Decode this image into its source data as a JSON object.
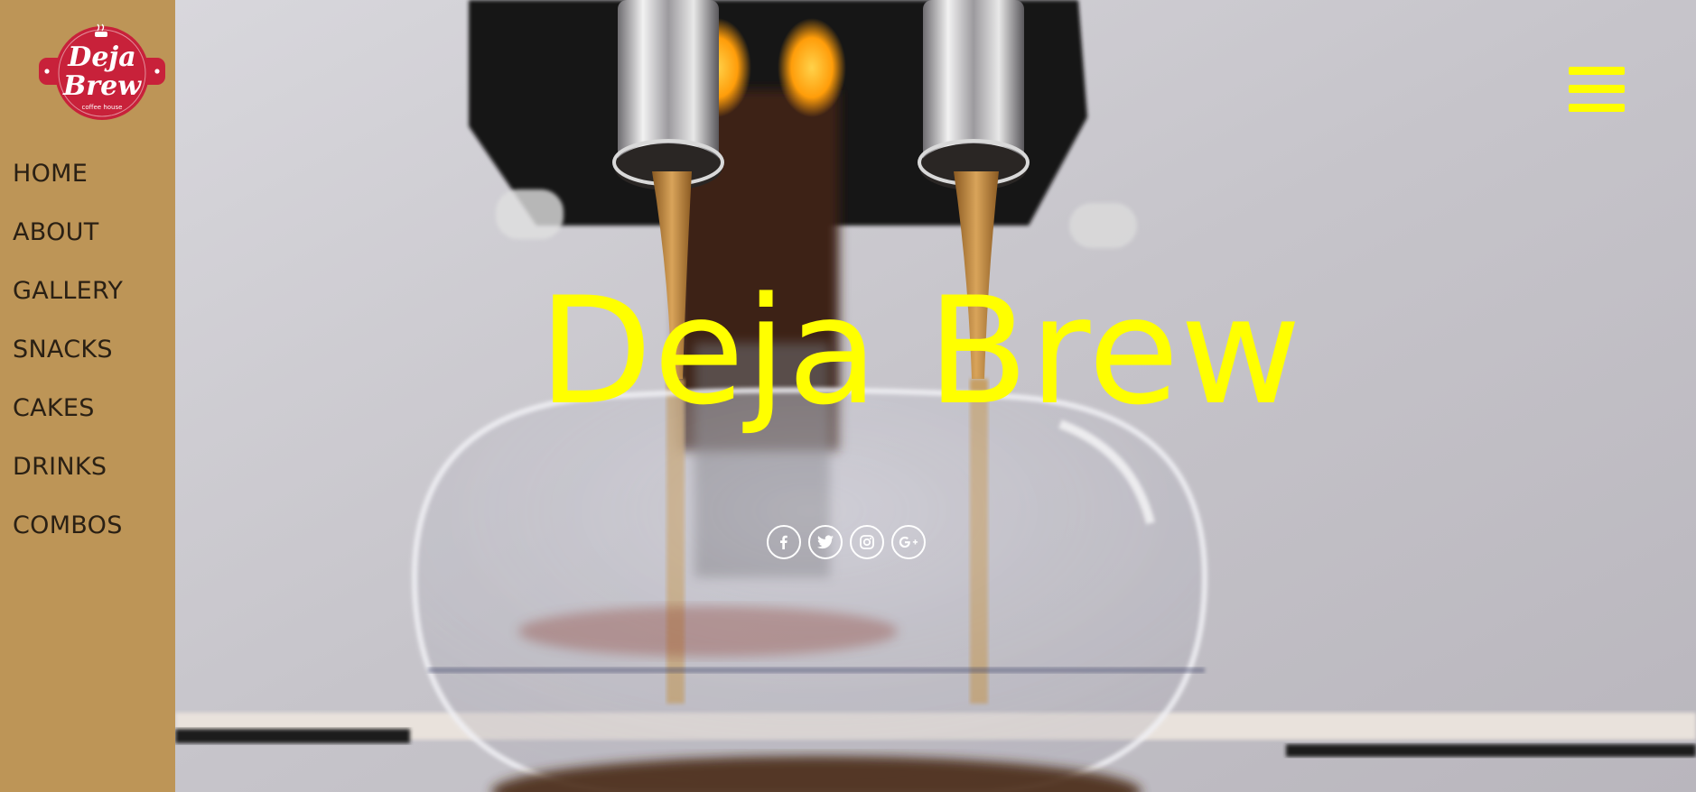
{
  "brand": {
    "logo_line1": "Deja",
    "logo_line2": "Brew",
    "logo_tagline": "coffee house",
    "primary_color": "#BD9557",
    "logo_color": "#C8213A",
    "accent_color": "#FFFF00"
  },
  "sidebar": {
    "items": [
      {
        "label": "HOME"
      },
      {
        "label": "ABOUT"
      },
      {
        "label": "GALLERY"
      },
      {
        "label": "SNACKS"
      },
      {
        "label": "CAKES"
      },
      {
        "label": "DRINKS"
      },
      {
        "label": "COMBOS"
      }
    ]
  },
  "hero": {
    "title": "Deja Brew",
    "background": "espresso-machine-pouring-image"
  },
  "header": {
    "menu_icon": "hamburger-menu-icon"
  },
  "social": [
    {
      "name": "facebook",
      "icon": "facebook-icon"
    },
    {
      "name": "twitter",
      "icon": "twitter-icon"
    },
    {
      "name": "instagram",
      "icon": "instagram-icon"
    },
    {
      "name": "google-plus",
      "icon": "google-plus-icon"
    }
  ]
}
